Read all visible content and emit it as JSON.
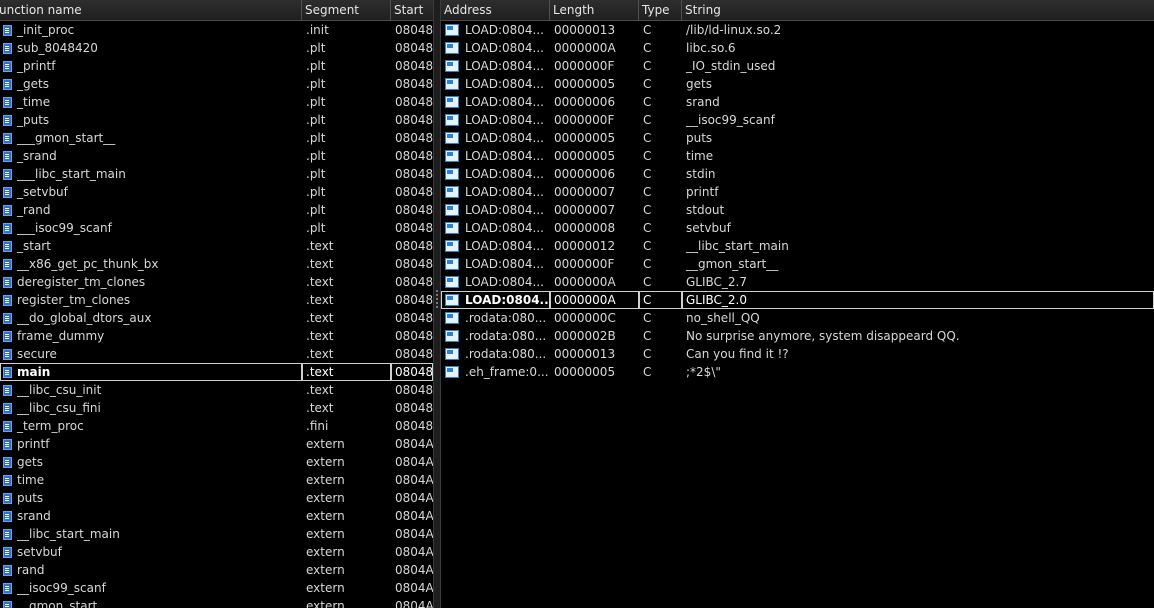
{
  "functions": {
    "columns": [
      "unction name",
      "Segment",
      "Start"
    ],
    "rows": [
      {
        "name": "_init_proc",
        "segment": ".init",
        "start": "08048"
      },
      {
        "name": "sub_8048420",
        "segment": ".plt",
        "start": "08048"
      },
      {
        "name": "_printf",
        "segment": ".plt",
        "start": "08048"
      },
      {
        "name": "_gets",
        "segment": ".plt",
        "start": "08048"
      },
      {
        "name": "_time",
        "segment": ".plt",
        "start": "08048"
      },
      {
        "name": "_puts",
        "segment": ".plt",
        "start": "08048"
      },
      {
        "name": "___gmon_start__",
        "segment": ".plt",
        "start": "08048"
      },
      {
        "name": "_srand",
        "segment": ".plt",
        "start": "08048"
      },
      {
        "name": "___libc_start_main",
        "segment": ".plt",
        "start": "08048"
      },
      {
        "name": "_setvbuf",
        "segment": ".plt",
        "start": "08048"
      },
      {
        "name": "_rand",
        "segment": ".plt",
        "start": "08048"
      },
      {
        "name": "___isoc99_scanf",
        "segment": ".plt",
        "start": "08048"
      },
      {
        "name": "_start",
        "segment": ".text",
        "start": "08048"
      },
      {
        "name": "__x86_get_pc_thunk_bx",
        "segment": ".text",
        "start": "08048"
      },
      {
        "name": "deregister_tm_clones",
        "segment": ".text",
        "start": "08048"
      },
      {
        "name": "register_tm_clones",
        "segment": ".text",
        "start": "08048"
      },
      {
        "name": "__do_global_dtors_aux",
        "segment": ".text",
        "start": "08048"
      },
      {
        "name": "frame_dummy",
        "segment": ".text",
        "start": "08048"
      },
      {
        "name": "secure",
        "segment": ".text",
        "start": "08048"
      },
      {
        "name": "main",
        "segment": ".text",
        "start": "08048",
        "selected": true
      },
      {
        "name": "__libc_csu_init",
        "segment": ".text",
        "start": "08048"
      },
      {
        "name": "__libc_csu_fini",
        "segment": ".text",
        "start": "08048"
      },
      {
        "name": "_term_proc",
        "segment": ".fini",
        "start": "08048"
      },
      {
        "name": "printf",
        "segment": "extern",
        "start": "0804A"
      },
      {
        "name": "gets",
        "segment": "extern",
        "start": "0804A"
      },
      {
        "name": "time",
        "segment": "extern",
        "start": "0804A"
      },
      {
        "name": "puts",
        "segment": "extern",
        "start": "0804A"
      },
      {
        "name": "srand",
        "segment": "extern",
        "start": "0804A"
      },
      {
        "name": "__libc_start_main",
        "segment": "extern",
        "start": "0804A"
      },
      {
        "name": "setvbuf",
        "segment": "extern",
        "start": "0804A"
      },
      {
        "name": "rand",
        "segment": "extern",
        "start": "0804A"
      },
      {
        "name": "__isoc99_scanf",
        "segment": "extern",
        "start": "0804A"
      },
      {
        "name": "__gmon_start__",
        "segment": "extern",
        "start": "0804A"
      }
    ]
  },
  "strings": {
    "columns": [
      "Address",
      "Length",
      "Type",
      "String"
    ],
    "rows": [
      {
        "address": "LOAD:0804...",
        "length": "00000013",
        "type": "C",
        "string": "/lib/ld-linux.so.2"
      },
      {
        "address": "LOAD:0804...",
        "length": "0000000A",
        "type": "C",
        "string": "libc.so.6"
      },
      {
        "address": "LOAD:0804...",
        "length": "0000000F",
        "type": "C",
        "string": "_IO_stdin_used"
      },
      {
        "address": "LOAD:0804...",
        "length": "00000005",
        "type": "C",
        "string": "gets"
      },
      {
        "address": "LOAD:0804...",
        "length": "00000006",
        "type": "C",
        "string": "srand"
      },
      {
        "address": "LOAD:0804...",
        "length": "0000000F",
        "type": "C",
        "string": "__isoc99_scanf"
      },
      {
        "address": "LOAD:0804...",
        "length": "00000005",
        "type": "C",
        "string": "puts"
      },
      {
        "address": "LOAD:0804...",
        "length": "00000005",
        "type": "C",
        "string": "time"
      },
      {
        "address": "LOAD:0804...",
        "length": "00000006",
        "type": "C",
        "string": "stdin"
      },
      {
        "address": "LOAD:0804...",
        "length": "00000007",
        "type": "C",
        "string": "printf"
      },
      {
        "address": "LOAD:0804...",
        "length": "00000007",
        "type": "C",
        "string": "stdout"
      },
      {
        "address": "LOAD:0804...",
        "length": "00000008",
        "type": "C",
        "string": "setvbuf"
      },
      {
        "address": "LOAD:0804...",
        "length": "00000012",
        "type": "C",
        "string": "__libc_start_main"
      },
      {
        "address": "LOAD:0804...",
        "length": "0000000F",
        "type": "C",
        "string": "__gmon_start__"
      },
      {
        "address": "LOAD:0804...",
        "length": "0000000A",
        "type": "C",
        "string": "GLIBC_2.7"
      },
      {
        "address": "LOAD:0804...",
        "length": "0000000A",
        "type": "C",
        "string": "GLIBC_2.0",
        "selected": true
      },
      {
        "address": ".rodata:080...",
        "length": "0000000C",
        "type": "C",
        "string": "no_shell_QQ"
      },
      {
        "address": ".rodata:080...",
        "length": "0000002B",
        "type": "C",
        "string": "No surprise anymore, system disappeard QQ."
      },
      {
        "address": ".rodata:080...",
        "length": "00000013",
        "type": "C",
        "string": "Can you find it !?"
      },
      {
        "address": ".eh_frame:0...",
        "length": "00000005",
        "type": "C",
        "string": ";*2$\\\""
      }
    ]
  },
  "icons": {
    "function": "function-icon",
    "string": "string-icon"
  },
  "colors": {
    "background": "#000000",
    "header": "#262626",
    "icon_blue": "#2f6fd1"
  }
}
